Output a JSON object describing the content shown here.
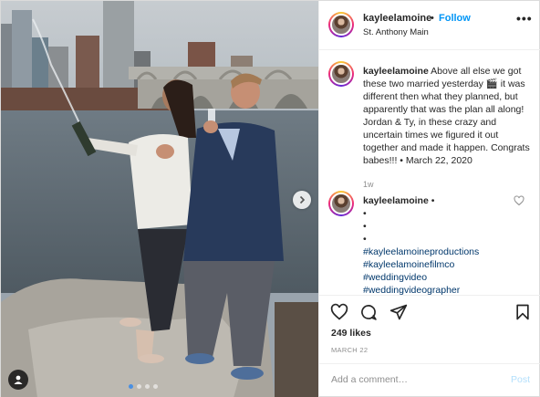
{
  "post": {
    "username": "kayleelamoine",
    "separator": "•",
    "follow_label": "Follow",
    "location": "St. Anthony Main",
    "more_icon": "more-horizontal-icon",
    "more_label": "•••"
  },
  "caption": {
    "username": "kayleelamoine",
    "text": "Above all else we got these two married yesterday 🎬 it was different then what they planned, but apparently that was the plan all along! Jordan & Ty, in these crazy and uncertain times we figured it out together and made it happen. Congrats babes!!! • March 22, 2020",
    "age": "1w"
  },
  "comment": {
    "username": "kayleelamoine",
    "separator": "•",
    "bullets": [
      "•",
      "•",
      "•"
    ],
    "hashtags": [
      "#kayleelamoineproductions",
      "#kayleelamoinefilmco",
      "#weddingvideo",
      "#weddingvideographer"
    ]
  },
  "actions": {
    "like_icon": "heart-icon",
    "comment_icon": "comment-icon",
    "share_icon": "paper-plane-icon",
    "save_icon": "bookmark-icon"
  },
  "likes_text": "249 likes",
  "date_text": "MARCH 22",
  "add_comment": {
    "placeholder": "Add a comment…",
    "post_label": "Post"
  },
  "carousel": {
    "total": 4,
    "active_index": 0
  },
  "colors": {
    "link_blue": "#0095f6",
    "hashtag_blue": "#00376b",
    "muted_gray": "#8e8e8e",
    "post_disabled": "#b2dffc",
    "carousel_active": "#4a90e2"
  }
}
